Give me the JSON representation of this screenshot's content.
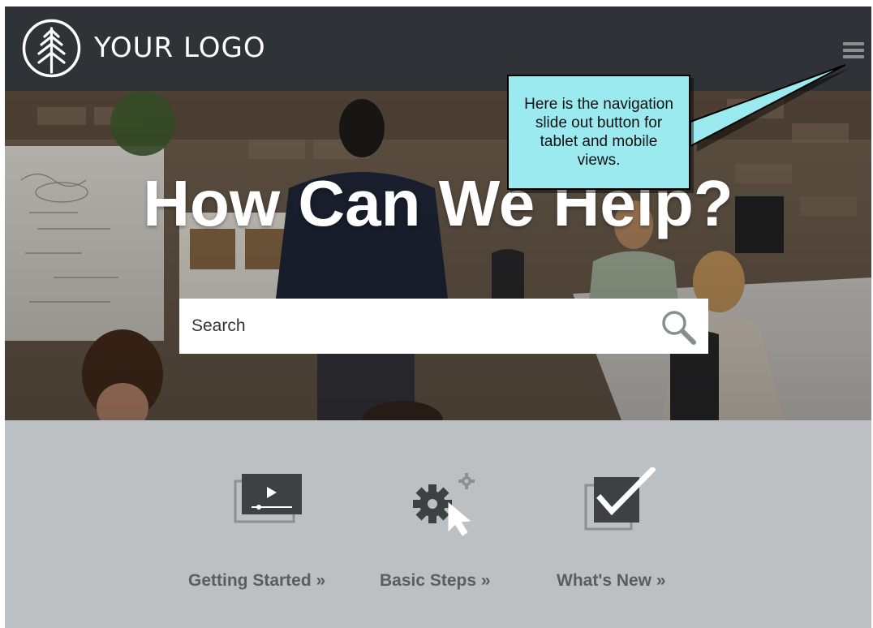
{
  "header": {
    "logo_text": "YOUR LOGO",
    "logo_icon": "tree-icon",
    "menu_icon": "hamburger-menu-icon"
  },
  "hero": {
    "title": "How Can We Help?",
    "search": {
      "placeholder": "Search",
      "value": "",
      "icon": "magnifier-icon"
    }
  },
  "callout": {
    "text": "Here is the navigation slide out button for tablet and mobile views."
  },
  "tiles": [
    {
      "label": "Getting Started »",
      "icon": "video-play-icon"
    },
    {
      "label": "Basic Steps »",
      "icon": "gears-cursor-icon"
    },
    {
      "label": "What's New »",
      "icon": "checkbox-check-icon"
    }
  ],
  "colors": {
    "header_bg": "#2f3337",
    "content_bg": "#bcc0c2",
    "callout_bg": "#9aeaf0",
    "tile_text": "#5a5e61",
    "icon_dark": "#3d4144"
  }
}
